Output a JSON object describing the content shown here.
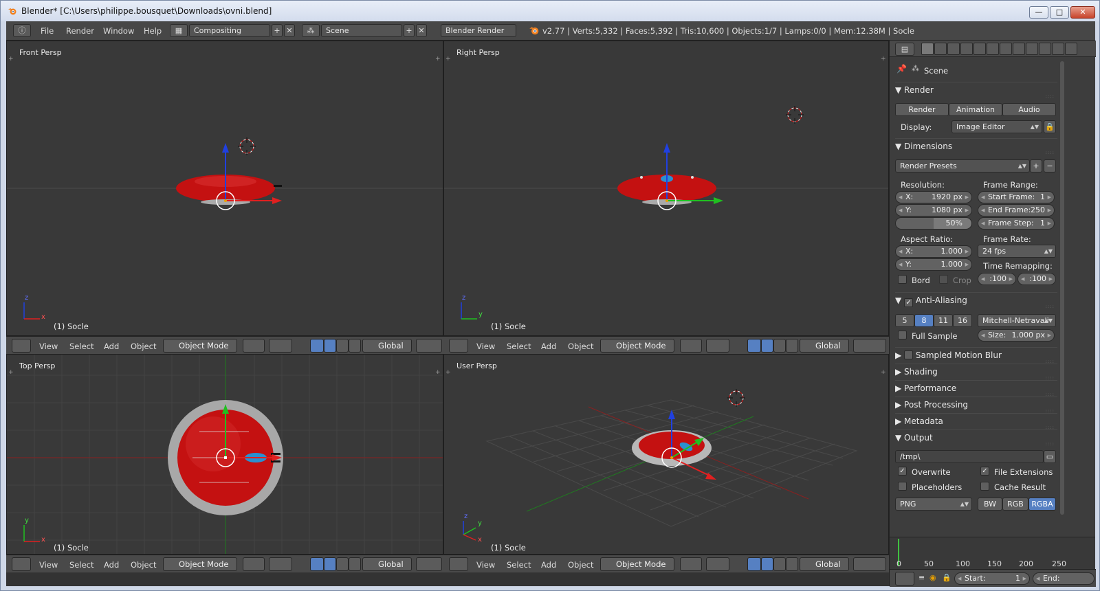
{
  "window": {
    "title": "Blender* [C:\\Users\\philippe.bousquet\\Downloads\\ovni.blend]",
    "buttons": [
      "—",
      "□",
      "✕"
    ]
  },
  "topbar": {
    "menus": [
      "File",
      "Render",
      "Window",
      "Help"
    ],
    "layout": "Compositing",
    "scene": "Scene",
    "engine": "Blender Render",
    "stats": "v2.77 | Verts:5,332 | Faces:5,392 | Tris:10,600 | Objects:1/7 | Lamps:0/0 | Mem:12.38M | Socle"
  },
  "viewports": [
    {
      "label": "Front Persp",
      "object": "(1) Socle"
    },
    {
      "label": "Right Persp",
      "object": "(1) Socle"
    },
    {
      "label": "Top Persp",
      "object": "(1) Socle"
    },
    {
      "label": "User Persp",
      "object": "(1) Socle"
    }
  ],
  "view_header": {
    "menus": [
      "View",
      "Select",
      "Add",
      "Object"
    ],
    "mode": "Object Mode",
    "orientation": "Global"
  },
  "axes": {
    "front": [
      "z",
      "x"
    ],
    "right": [
      "z",
      "y"
    ],
    "top": [
      "y",
      "x"
    ],
    "user": [
      "z",
      "y",
      "x"
    ]
  },
  "properties": {
    "context": "Scene",
    "render": {
      "title": "Render",
      "buttons": [
        "Render",
        "Animation",
        "Audio"
      ],
      "display_label": "Display:",
      "display_value": "Image Editor"
    },
    "dimensions": {
      "title": "Dimensions",
      "presets": "Render Presets",
      "resolution_label": "Resolution:",
      "res_x_label": "X:",
      "res_x": "1920 px",
      "res_y_label": "Y:",
      "res_y": "1080 px",
      "res_pct": "50%",
      "frame_range_label": "Frame Range:",
      "start_label": "Start Frame:",
      "start": "1",
      "end_label": "End Frame:",
      "end": "250",
      "step_label": "Frame Step:",
      "step": "1",
      "aspect_label": "Aspect Ratio:",
      "asp_x_label": "X:",
      "asp_x": "1.000",
      "asp_y_label": "Y:",
      "asp_y": "1.000",
      "frame_rate_label": "Frame Rate:",
      "frame_rate": "24 fps",
      "remap_label": "Time Remapping:",
      "remap_old": ":100",
      "remap_new": ":100",
      "bord": "Bord",
      "crop": "Crop"
    },
    "anti_aliasing": {
      "title": "Anti-Aliasing",
      "samples": [
        "5",
        "8",
        "11",
        "16"
      ],
      "selected_sample": "8",
      "filter": "Mitchell-Netravali",
      "full_sample": "Full Sample",
      "size_label": "Size:",
      "size": "1.000 px"
    },
    "collapsed_sections": [
      "Sampled Motion Blur",
      "Shading",
      "Performance",
      "Post Processing",
      "Metadata"
    ],
    "output": {
      "title": "Output",
      "path": "/tmp\\",
      "overwrite": "Overwrite",
      "file_extensions": "File Extensions",
      "placeholders": "Placeholders",
      "cache_result": "Cache Result",
      "format": "PNG",
      "color_modes": [
        "BW",
        "RGB",
        "RGBA"
      ],
      "selected_color": "RGBA"
    }
  },
  "timeline": {
    "ticks": [
      "0",
      "50",
      "100",
      "150",
      "200",
      "250"
    ],
    "start_label": "Start:",
    "start": "1",
    "end_label": "End:"
  },
  "colors": {
    "accent": "#5680c2",
    "object_red": "#c41111",
    "axis_x": "#e02020",
    "axis_y": "#20c020",
    "axis_z": "#2040e0"
  }
}
